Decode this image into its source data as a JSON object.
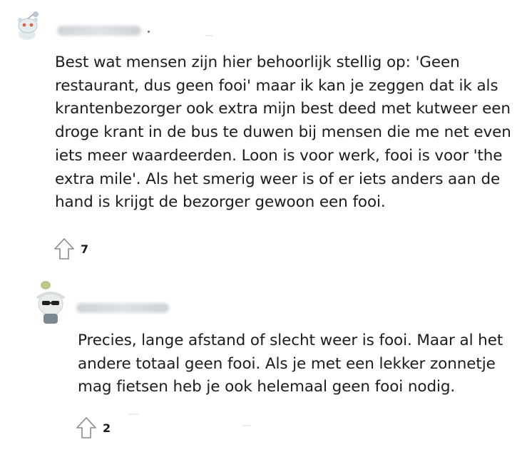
{
  "comments": [
    {
      "username": "",
      "body": "Best wat mensen zijn hier behoorlijk stellig op: 'Geen restaurant, dus geen fooi' maar ik kan je zeggen dat ik als krantenbezorger ook extra mijn best deed met kutweer een droge krant in de bus te duwen bij mensen die me net even iets meer waardeerden. Loon is voor werk, fooi is voor 'the extra mile'. Als het smerig weer is of er iets anders aan de hand is krijgt de bezorger gewoon een fooi.",
      "lines": [
        "Best wat mensen zijn hier behoorlijk stellig op: 'Geen",
        "restaurant, dus geen fooi' maar ik kan je zeggen dat ik als",
        "krantenbezorger ook extra mijn best deed met kutweer een",
        "droge krant in de bus te duwen bij mensen die me net even",
        "iets meer waardeerden. Loon is voor werk, fooi is voor 'the",
        "extra mile'. Als het smerig weer is of er iets anders aan de",
        "hand is krijgt de bezorger gewoon een fooi."
      ],
      "upvotes": "7",
      "avatar_icon": "snoo-avatar-icon"
    },
    {
      "username": "",
      "body": "Precies, lange afstand of slecht weer is fooi. Maar al het andere totaal geen fooi. Als je met een lekker zonnetje mag fietsen heb je ook helemaal geen fooi nodig.",
      "lines": [
        "Precies, lange afstand of slecht weer is fooi. Maar al het",
        "andere totaal geen fooi. Als je met een lekker zonnetje",
        "mag fietsen heb je ook helemaal geen fooi nodig."
      ],
      "upvotes": "2",
      "avatar_icon": "snoo-avatar-icon"
    }
  ],
  "icons": {
    "upvote": "upvote-arrow-icon"
  },
  "colors": {
    "text": "#1c1c1c",
    "icon_stroke": "#878a8c"
  }
}
